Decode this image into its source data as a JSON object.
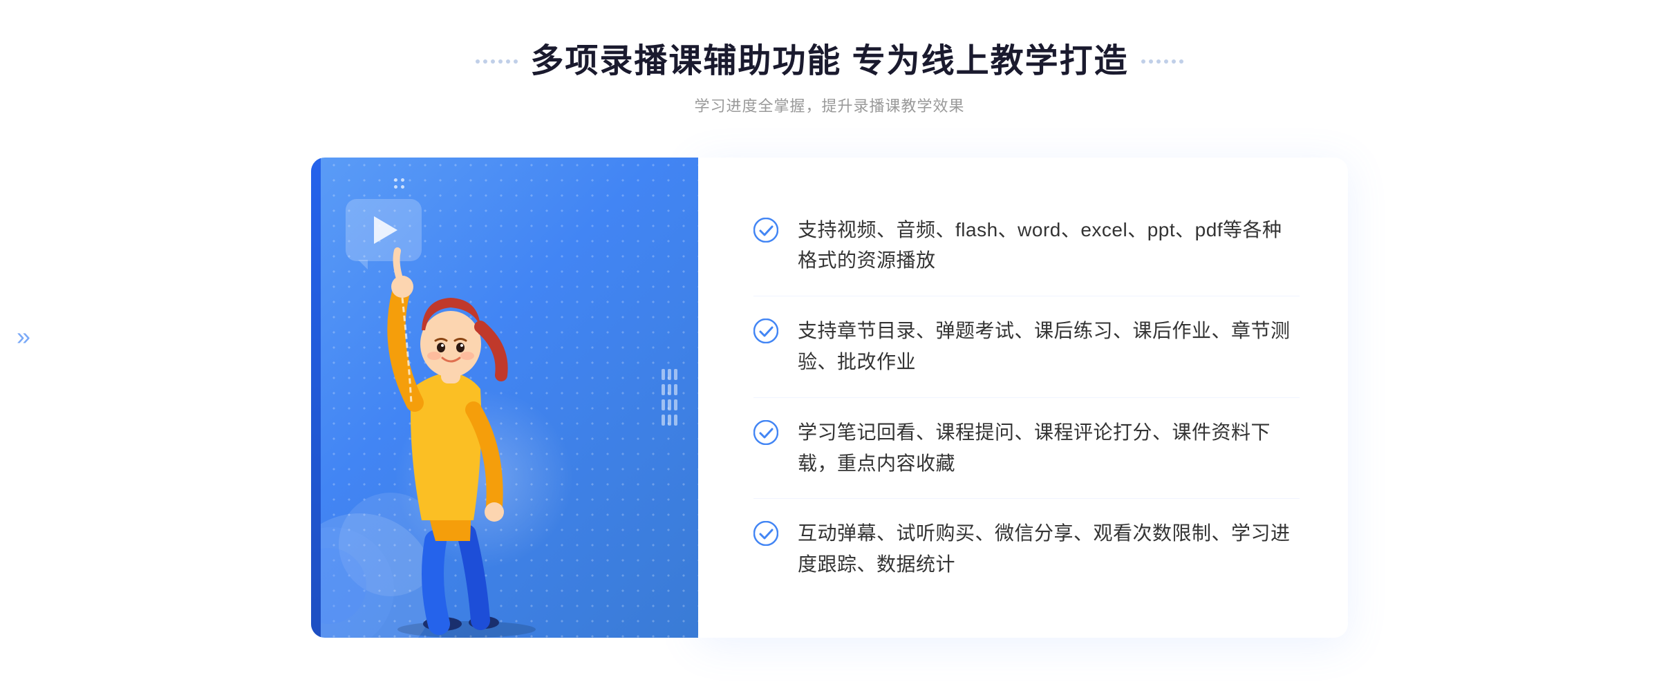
{
  "header": {
    "title": "多项录播课辅助功能 专为线上教学打造",
    "subtitle": "学习进度全掌握，提升录播课教学效果",
    "dots_left": [
      "",
      "",
      ""
    ],
    "dots_right": [
      "",
      "",
      ""
    ]
  },
  "features": [
    {
      "id": "feature-1",
      "text": "支持视频、音频、flash、word、excel、ppt、pdf等各种格式的资源播放"
    },
    {
      "id": "feature-2",
      "text": "支持章节目录、弹题考试、课后练习、课后作业、章节测验、批改作业"
    },
    {
      "id": "feature-3",
      "text": "学习笔记回看、课程提问、课程评论打分、课件资料下载，重点内容收藏"
    },
    {
      "id": "feature-4",
      "text": "互动弹幕、试听购买、微信分享、观看次数限制、学习进度跟踪、数据统计"
    }
  ],
  "left_nav": {
    "chevron": "»"
  },
  "colors": {
    "primary": "#4285f4",
    "text_dark": "#1a1a2e",
    "text_gray": "#999",
    "check_color": "#4285f4"
  }
}
